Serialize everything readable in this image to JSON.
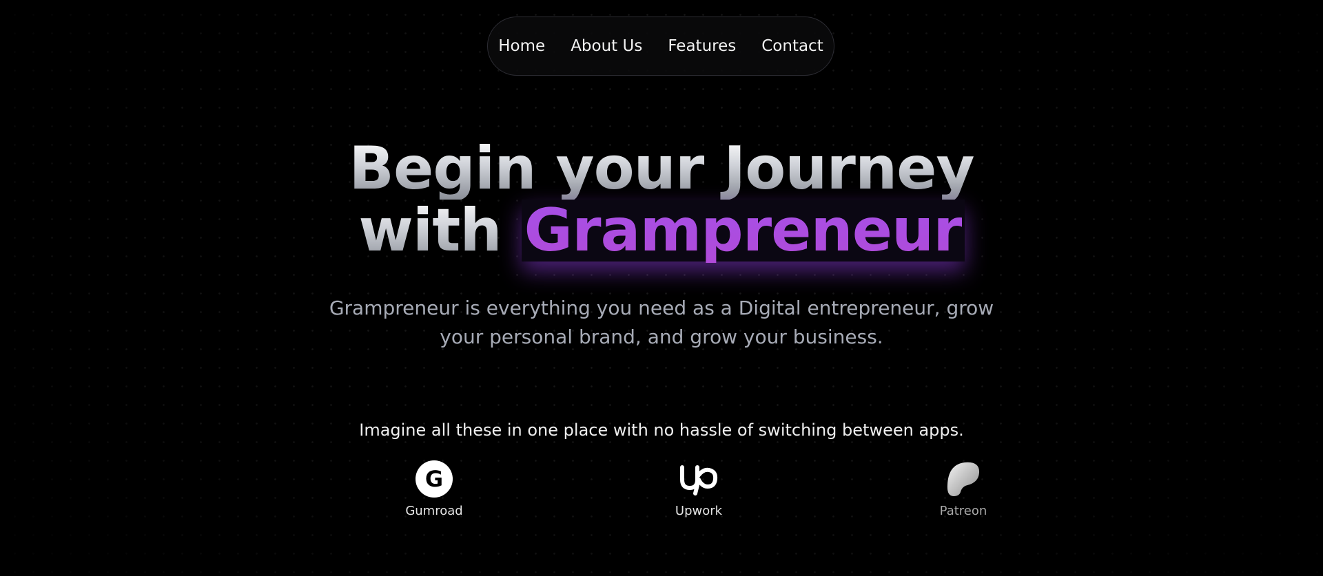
{
  "nav": {
    "items": [
      {
        "label": "Home"
      },
      {
        "label": "About Us"
      },
      {
        "label": "Features"
      },
      {
        "label": "Contact"
      }
    ]
  },
  "hero": {
    "line1": "Begin your Journey",
    "line2_prefix": "with",
    "line2_highlight": "Grampreneur",
    "subtitle": "Grampreneur is everything you need as a Digital entrepreneur, grow your personal brand, and grow your business.",
    "accent_color": "#a94be4"
  },
  "platforms": {
    "tagline": "Imagine all these in one place with no hassle of switching between apps.",
    "items": [
      {
        "name": "Gumroad",
        "icon": "gumroad-icon"
      },
      {
        "name": "Upwork",
        "icon": "upwork-icon"
      },
      {
        "name": "Patreon",
        "icon": "patreon-icon"
      }
    ]
  }
}
